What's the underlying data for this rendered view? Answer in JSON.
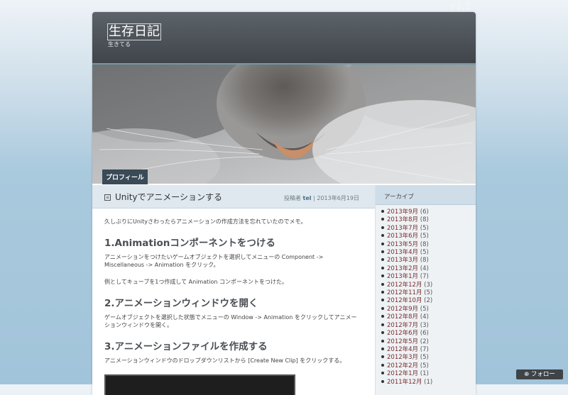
{
  "version": "v1.2",
  "site": {
    "title": "生存日記",
    "description": "生きてる"
  },
  "hero": {
    "profile_tab": "プロフィール"
  },
  "post": {
    "title": "Unityでアニメーションする",
    "meta_prefix": "投稿者",
    "author": "tel",
    "separator": "|",
    "date": "2013年6月19日",
    "intro": "久しぶりにUnityさわったらアニメーションの作成方法を忘れていたのでメモ。",
    "sections": [
      {
        "heading": "1.Animationコンポーネントをつける",
        "paragraphs": [
          "アニメーションをつけたいゲームオブジェクトを選択してメニューの Component -> Miscellaneous -> Animation をクリック。",
          "例としてキューブを1つ作成して Animation コンポーネントをつけた。"
        ]
      },
      {
        "heading": "2.アニメーションウィンドウを開く",
        "paragraphs": [
          "ゲームオブジェクトを選択した状態でメニューの Window -> Animation をクリックしてアニメーションウィンドウを開く。"
        ]
      },
      {
        "heading": "3.アニメーションファイルを作成する",
        "paragraphs": [
          "アニメーションウィンドウのドロップダウンリストから [Create New Clip] をクリックする。"
        ]
      }
    ]
  },
  "sidebar": {
    "title": "アーカイブ",
    "archive": [
      {
        "label": "2013年9月",
        "count": "(6)"
      },
      {
        "label": "2013年8月",
        "count": "(8)"
      },
      {
        "label": "2013年7月",
        "count": "(5)"
      },
      {
        "label": "2013年6月",
        "count": "(5)"
      },
      {
        "label": "2013年5月",
        "count": "(8)"
      },
      {
        "label": "2013年4月",
        "count": "(5)"
      },
      {
        "label": "2013年3月",
        "count": "(8)"
      },
      {
        "label": "2013年2月",
        "count": "(4)"
      },
      {
        "label": "2013年1月",
        "count": "(7)"
      },
      {
        "label": "2012年12月",
        "count": "(3)"
      },
      {
        "label": "2012年11月",
        "count": "(5)"
      },
      {
        "label": "2012年10月",
        "count": "(2)"
      },
      {
        "label": "2012年9月",
        "count": "(5)"
      },
      {
        "label": "2012年8月",
        "count": "(4)"
      },
      {
        "label": "2012年7月",
        "count": "(3)"
      },
      {
        "label": "2012年6月",
        "count": "(6)"
      },
      {
        "label": "2012年5月",
        "count": "(2)"
      },
      {
        "label": "2012年4月",
        "count": "(7)"
      },
      {
        "label": "2012年3月",
        "count": "(5)"
      },
      {
        "label": "2012年2月",
        "count": "(5)"
      },
      {
        "label": "2012年1月",
        "count": "(1)"
      },
      {
        "label": "2011年12月",
        "count": "(1)"
      }
    ]
  },
  "follow": {
    "icon": "plus-icon",
    "label": "フォロー"
  }
}
